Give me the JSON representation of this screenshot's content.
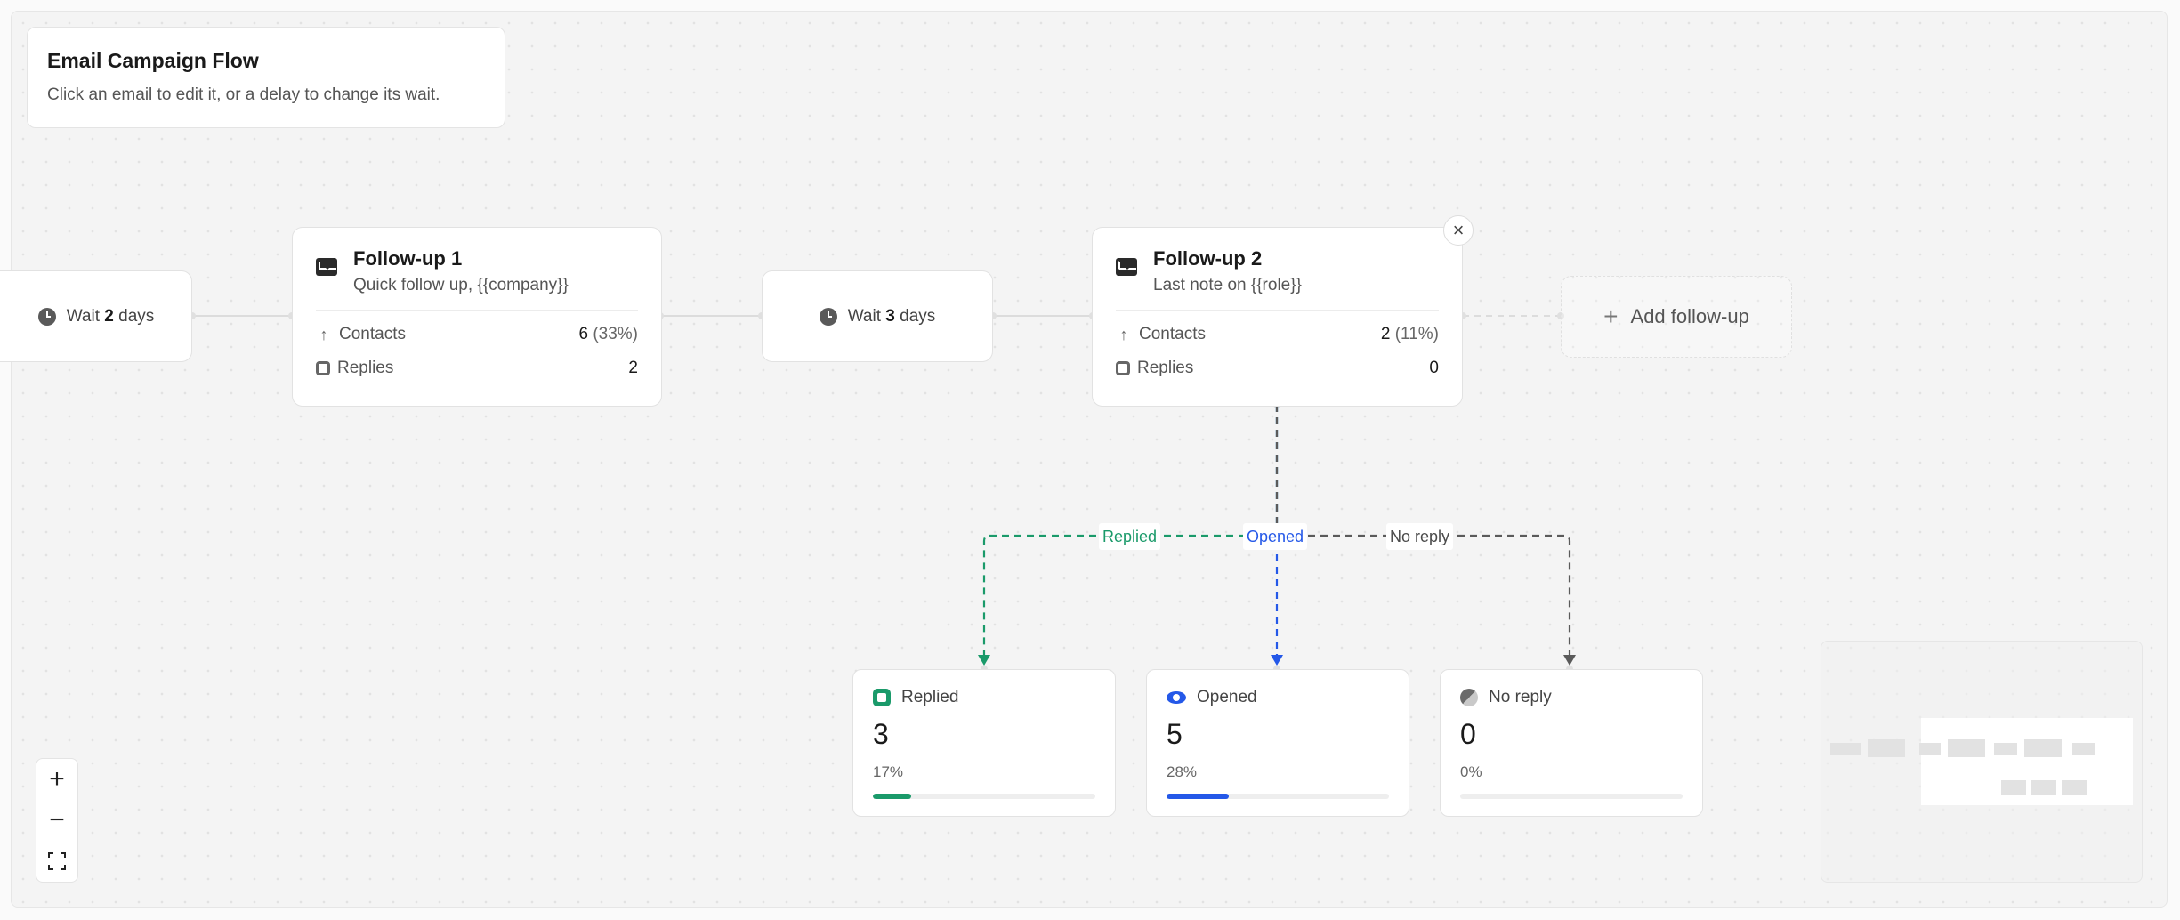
{
  "info": {
    "title": "Email Campaign Flow",
    "subtitle": "Click an email to edit it, or a delay to change its wait."
  },
  "delays": [
    {
      "prefix": "Wait",
      "value": "2",
      "suffix": "days"
    },
    {
      "prefix": "Wait",
      "value": "3",
      "suffix": "days"
    }
  ],
  "emails": [
    {
      "name": "Follow-up 1",
      "subject": "Quick follow up, {{company}}",
      "contacts_label": "Contacts",
      "contacts_value": "6",
      "contacts_pct": "(33%)",
      "replies_label": "Replies",
      "replies_value": "2"
    },
    {
      "name": "Follow-up 2",
      "subject": "Last note on {{role}}",
      "contacts_label": "Contacts",
      "contacts_value": "2",
      "contacts_pct": "(11%)",
      "replies_label": "Replies",
      "replies_value": "0"
    }
  ],
  "add_followup": {
    "label": "Add follow-up"
  },
  "branches": [
    {
      "label": "Replied",
      "color": "#1a9a6a"
    },
    {
      "label": "Opened",
      "color": "#2458e8"
    },
    {
      "label": "No reply",
      "color": "#5a5a5a"
    }
  ],
  "outcomes": [
    {
      "label": "Replied",
      "count": "3",
      "pct": "17%",
      "fraction": 0.17,
      "color": "#1a9a6a",
      "icon": "replied-icon"
    },
    {
      "label": "Opened",
      "count": "5",
      "pct": "28%",
      "fraction": 0.28,
      "color": "#2458e8",
      "icon": "eye-icon"
    },
    {
      "label": "No reply",
      "count": "0",
      "pct": "0%",
      "fraction": 0,
      "color": "#8a8a8a",
      "icon": "half-circle-icon"
    }
  ],
  "zoom": {
    "in": "+",
    "out": "−"
  },
  "close": "×"
}
